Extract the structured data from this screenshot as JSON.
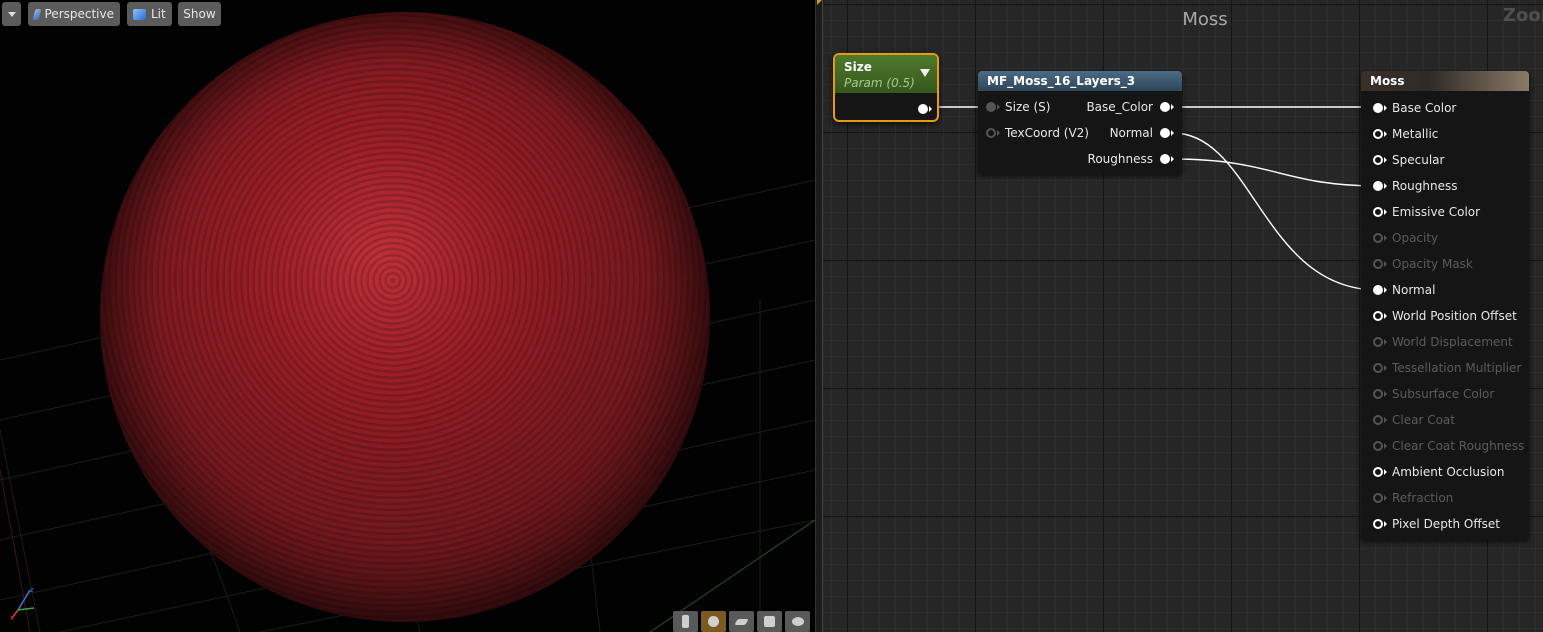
{
  "viewport": {
    "toolbar": {
      "perspective_label": "Perspective",
      "lit_label": "Lit",
      "show_label": "Show"
    },
    "preview": {
      "shape": "sphere",
      "tint": "#8c1c24"
    },
    "bottom_icons": [
      "cylinder-icon",
      "sphere-icon",
      "plane-icon",
      "cube-icon",
      "teapot-icon"
    ]
  },
  "graph": {
    "title": "Moss",
    "zoom_label": "Zoom",
    "nodes": {
      "size_param": {
        "title": "Size",
        "subtitle": "Param (0.5)"
      },
      "material_function": {
        "title": "MF_Moss_16_Layers_3",
        "inputs": [
          "Size (S)",
          "TexCoord (V2)"
        ],
        "outputs": [
          "Base_Color",
          "Normal",
          "Roughness"
        ]
      },
      "result": {
        "title": "Moss",
        "pins": [
          {
            "label": "Base Color",
            "connected": true,
            "enabled": true
          },
          {
            "label": "Metallic",
            "connected": false,
            "enabled": true
          },
          {
            "label": "Specular",
            "connected": false,
            "enabled": true
          },
          {
            "label": "Roughness",
            "connected": true,
            "enabled": true
          },
          {
            "label": "Emissive Color",
            "connected": false,
            "enabled": true
          },
          {
            "label": "Opacity",
            "connected": false,
            "enabled": false
          },
          {
            "label": "Opacity Mask",
            "connected": false,
            "enabled": false
          },
          {
            "label": "Normal",
            "connected": true,
            "enabled": true
          },
          {
            "label": "World Position Offset",
            "connected": false,
            "enabled": true
          },
          {
            "label": "World Displacement",
            "connected": false,
            "enabled": false
          },
          {
            "label": "Tessellation Multiplier",
            "connected": false,
            "enabled": false
          },
          {
            "label": "Subsurface Color",
            "connected": false,
            "enabled": false
          },
          {
            "label": "Clear Coat",
            "connected": false,
            "enabled": false
          },
          {
            "label": "Clear Coat Roughness",
            "connected": false,
            "enabled": false
          },
          {
            "label": "Ambient Occlusion",
            "connected": false,
            "enabled": true
          },
          {
            "label": "Refraction",
            "connected": false,
            "enabled": false
          },
          {
            "label": "Pixel Depth Offset",
            "connected": false,
            "enabled": true
          }
        ]
      }
    },
    "colors": {
      "param_node": "#4f7a2d",
      "function_node": "#4b6b85",
      "selection": "#e89a10",
      "wire": "#ffffff"
    }
  }
}
